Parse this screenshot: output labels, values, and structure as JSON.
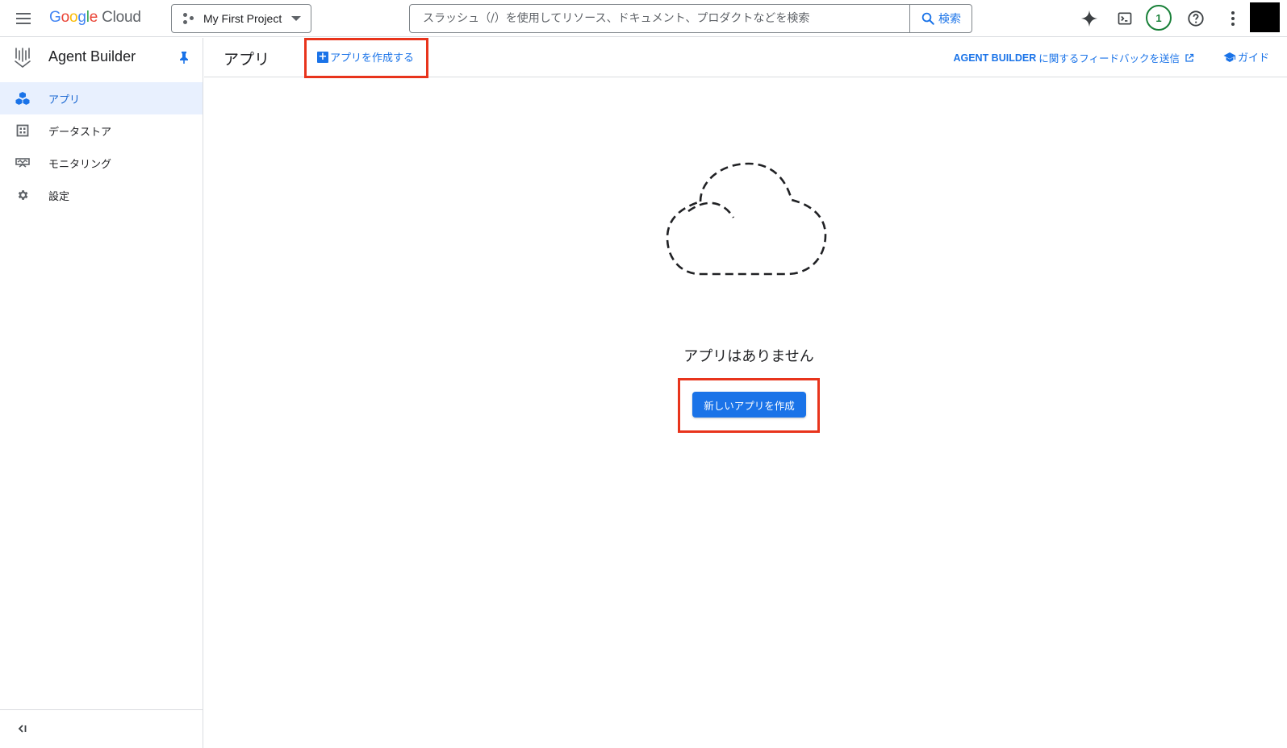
{
  "colors": {
    "accent": "#1a73e8",
    "highlight": "#e8341c",
    "badge": "#188038"
  },
  "topbar": {
    "logo": {
      "google": [
        "G",
        "o",
        "o",
        "g",
        "l",
        "e"
      ],
      "cloud": "Cloud"
    },
    "project": {
      "name": "My First Project"
    },
    "search": {
      "placeholder": "スラッシュ（/）を使用してリソース、ドキュメント、プロダクトなどを検索",
      "button_label": "検索"
    },
    "icons": [
      "gemini-icon",
      "cloud-shell-icon",
      "help-icon",
      "more-vert-icon"
    ],
    "notification_count": "1"
  },
  "sidebar": {
    "product_title": "Agent Builder",
    "items": [
      {
        "label": "アプリ",
        "icon": "apps-icon",
        "active": true
      },
      {
        "label": "データストア",
        "icon": "data-store-icon",
        "active": false
      },
      {
        "label": "モニタリング",
        "icon": "monitoring-icon",
        "active": false
      },
      {
        "label": "設定",
        "icon": "settings-icon",
        "active": false
      }
    ]
  },
  "main": {
    "title": "アプリ",
    "create_link_label": "アプリを作成する",
    "feedback": {
      "brand": "AGENT BUILDER",
      "text": "に関するフィードバックを送信"
    },
    "guide_label": "ガイド",
    "empty_state": {
      "message": "アプリはありません",
      "button_label": "新しいアプリを作成"
    }
  }
}
